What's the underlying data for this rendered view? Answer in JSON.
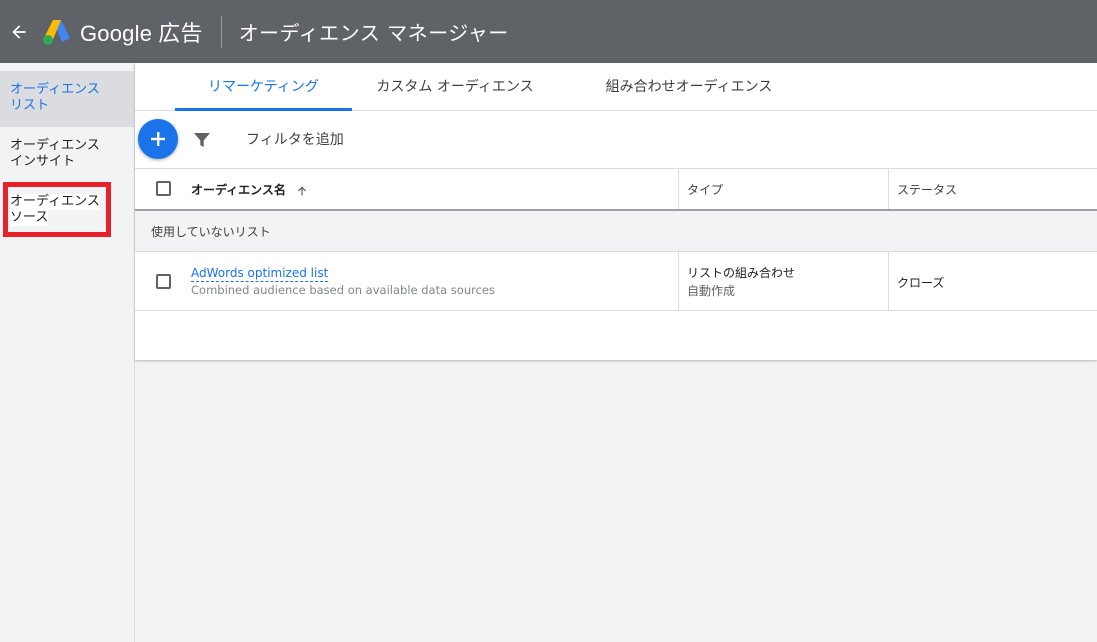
{
  "header": {
    "brand": "Google",
    "brand_suffix": "広告",
    "title": "オーディエンス マネージャー"
  },
  "sidebar": {
    "items": [
      {
        "label_line1": "オーディエンス",
        "label_line2": "リスト",
        "active": true
      },
      {
        "label_line1": "オーディエンス",
        "label_line2": "インサイト",
        "active": false
      },
      {
        "label_line1": "オーディエンス",
        "label_line2": "ソース",
        "active": false,
        "highlighted": true
      }
    ]
  },
  "tabs": [
    {
      "label": "リマーケティング",
      "active": true
    },
    {
      "label": "カスタム オーディエンス",
      "active": false
    },
    {
      "label": "組み合わせオーディエンス",
      "active": false
    }
  ],
  "toolbar": {
    "add_icon": "plus-icon",
    "filter_icon": "filter-icon",
    "filter_label": "フィルタを追加"
  },
  "table": {
    "columns": {
      "name": "オーディエンス名",
      "type": "タイプ",
      "status": "ステータス"
    },
    "group_label": "使用していないリスト",
    "rows": [
      {
        "name": "AdWords optimized list",
        "description": "Combined audience based on available data sources",
        "type": "リストの組み合わせ",
        "type_sub": "自動作成",
        "status": "クローズ"
      }
    ]
  },
  "colors": {
    "header_bg": "#5f6368",
    "accent": "#1a73e8",
    "highlight": "#e8202a"
  }
}
